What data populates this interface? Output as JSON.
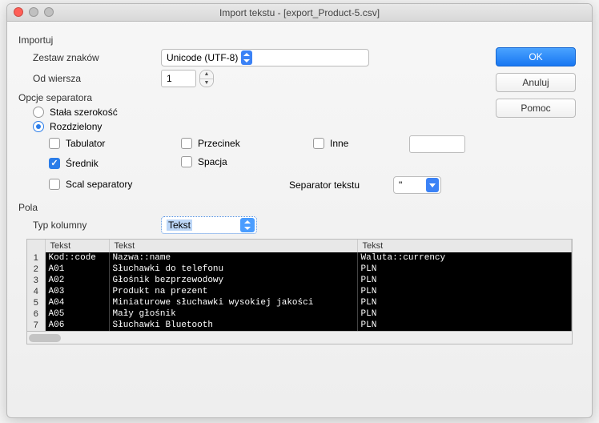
{
  "title": "Import tekstu - [export_Product-5.csv]",
  "buttons": {
    "ok": "OK",
    "cancel": "Anuluj",
    "help": "Pomoc"
  },
  "import": {
    "section": "Importuj",
    "charset_label": "Zestaw znaków",
    "charset_value": "Unicode (UTF-8)",
    "fromrow_label": "Od wiersza",
    "fromrow_value": "1"
  },
  "sepopt": {
    "section": "Opcje separatora",
    "fixed": "Stała szerokość",
    "delimited": "Rozdzielony",
    "tab": "Tabulator",
    "comma": "Przecinek",
    "other": "Inne",
    "semicolon": "Średnik",
    "space": "Spacja",
    "merge": "Scal separatory",
    "textsep_label": "Separator tekstu",
    "textsep_value": "\""
  },
  "fields": {
    "section": "Pola",
    "coltype_label": "Typ kolumny",
    "coltype_value": "Tekst",
    "headers": [
      "Tekst",
      "Tekst",
      "Tekst"
    ]
  },
  "chart_data": {
    "type": "table",
    "columns": [
      "Tekst",
      "Tekst",
      "Tekst"
    ],
    "rows": [
      [
        "Kod::code",
        "Nazwa::name",
        "Waluta::currency"
      ],
      [
        "A01",
        "Słuchawki do telefonu",
        "PLN"
      ],
      [
        "A02",
        "Głośnik bezprzewodowy",
        "PLN"
      ],
      [
        "A03",
        "Produkt na prezent",
        "PLN"
      ],
      [
        "A04",
        "Miniaturowe słuchawki wysokiej jakości",
        "PLN"
      ],
      [
        "A05",
        "Mały głośnik",
        "PLN"
      ],
      [
        "A06",
        "Słuchawki Bluetooth",
        "PLN"
      ]
    ]
  }
}
